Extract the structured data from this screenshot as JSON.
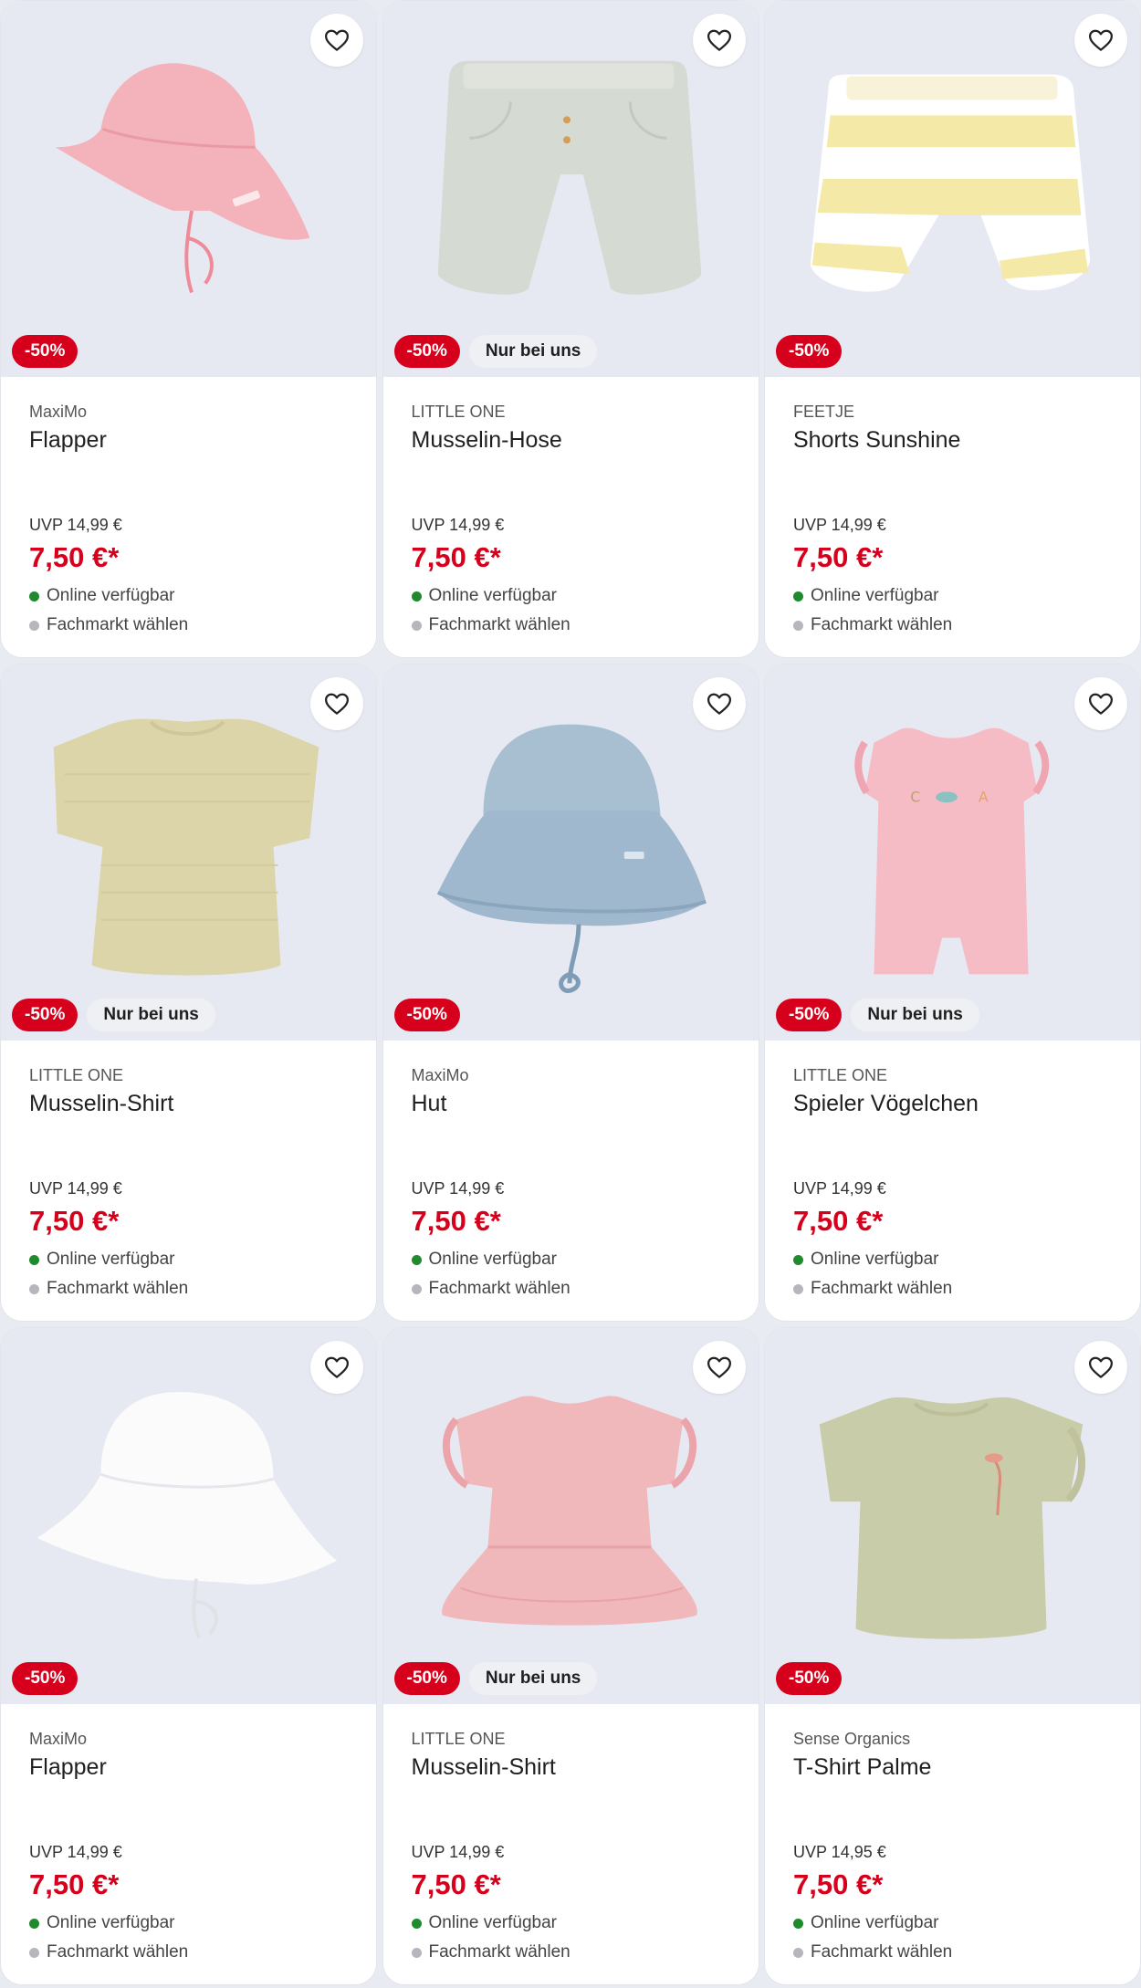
{
  "colors": {
    "sale": "#d6001c",
    "online_dot": "#1f8a2e",
    "store_dot": "#b5b7bd",
    "image_bg": "#e7e9f2"
  },
  "labels": {
    "online": "Online verfügbar",
    "store": "Fachmarkt wählen",
    "wish_icon": "heart-outline-icon"
  },
  "products": [
    {
      "brand": "MaxiMo",
      "name": "Flapper",
      "uvp": "UVP 14,99 €",
      "price": "7,50 €*",
      "sale_badge": "-50%",
      "exclusive_badge": "",
      "image": "pink-sun-hat"
    },
    {
      "brand": "LITTLE ONE",
      "name": "Musselin-Hose",
      "uvp": "UVP 14,99 €",
      "price": "7,50 €*",
      "sale_badge": "-50%",
      "exclusive_badge": "Nur bei uns",
      "image": "sage-shorts"
    },
    {
      "brand": "FEETJE",
      "name": "Shorts Sunshine",
      "uvp": "UVP 14,99 €",
      "price": "7,50 €*",
      "sale_badge": "-50%",
      "exclusive_badge": "",
      "image": "yellow-striped-shorts"
    },
    {
      "brand": "LITTLE ONE",
      "name": "Musselin-Shirt",
      "uvp": "UVP 14,99 €",
      "price": "7,50 €*",
      "sale_badge": "-50%",
      "exclusive_badge": "Nur bei uns",
      "image": "beige-shirt"
    },
    {
      "brand": "MaxiMo",
      "name": "Hut",
      "uvp": "UVP 14,99 €",
      "price": "7,50 €*",
      "sale_badge": "-50%",
      "exclusive_badge": "",
      "image": "blue-bucket-hat"
    },
    {
      "brand": "LITTLE ONE",
      "name": "Spieler Vögelchen",
      "uvp": "UVP 14,99 €",
      "price": "7,50 €*",
      "sale_badge": "-50%",
      "exclusive_badge": "Nur bei uns",
      "image": "pink-romper"
    },
    {
      "brand": "MaxiMo",
      "name": "Flapper",
      "uvp": "UVP 14,99 €",
      "price": "7,50 €*",
      "sale_badge": "-50%",
      "exclusive_badge": "",
      "image": "white-sun-hat"
    },
    {
      "brand": "LITTLE ONE",
      "name": "Musselin-Shirt",
      "uvp": "UVP 14,99 €",
      "price": "7,50 €*",
      "sale_badge": "-50%",
      "exclusive_badge": "Nur bei uns",
      "image": "pink-peplum-shirt"
    },
    {
      "brand": "Sense Organics",
      "name": "T-Shirt Palme",
      "uvp": "UVP 14,95 €",
      "price": "7,50 €*",
      "sale_badge": "-50%",
      "exclusive_badge": "",
      "image": "olive-palm-tshirt"
    }
  ]
}
